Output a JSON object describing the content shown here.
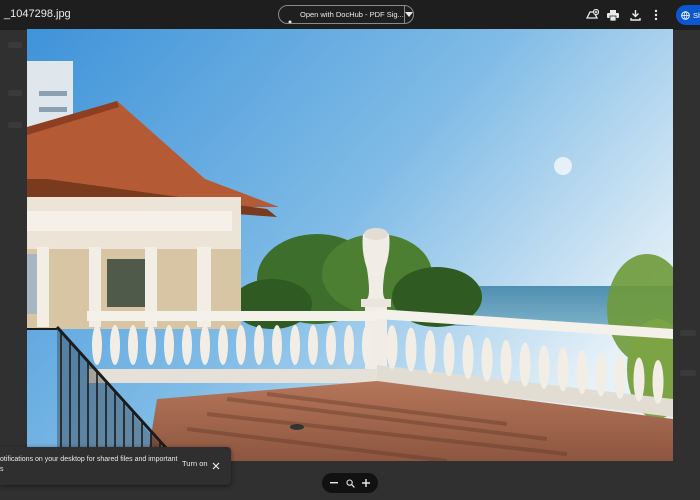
{
  "header": {
    "file_title": "_1047298.jpg",
    "open_with_label": "Open with DocHub - PDF Sig...",
    "share_label": "Sh"
  },
  "snackbar": {
    "message": "otifications on your desktop for shared files and important\ns",
    "action_label": "Turn on"
  },
  "icons": {
    "add_to_drive": "add-to-drive-icon",
    "print": "print-icon",
    "download": "download-icon",
    "more": "more-vert-icon",
    "share": "share-lock-icon",
    "dropdown": "chevron-down-icon",
    "close": "close-icon",
    "zoom_out": "zoom-out-icon",
    "zoom_fit": "zoom-search-icon",
    "zoom_in": "zoom-in-icon"
  },
  "colors": {
    "accent": "#0b57d0",
    "overlay": "#262626"
  }
}
